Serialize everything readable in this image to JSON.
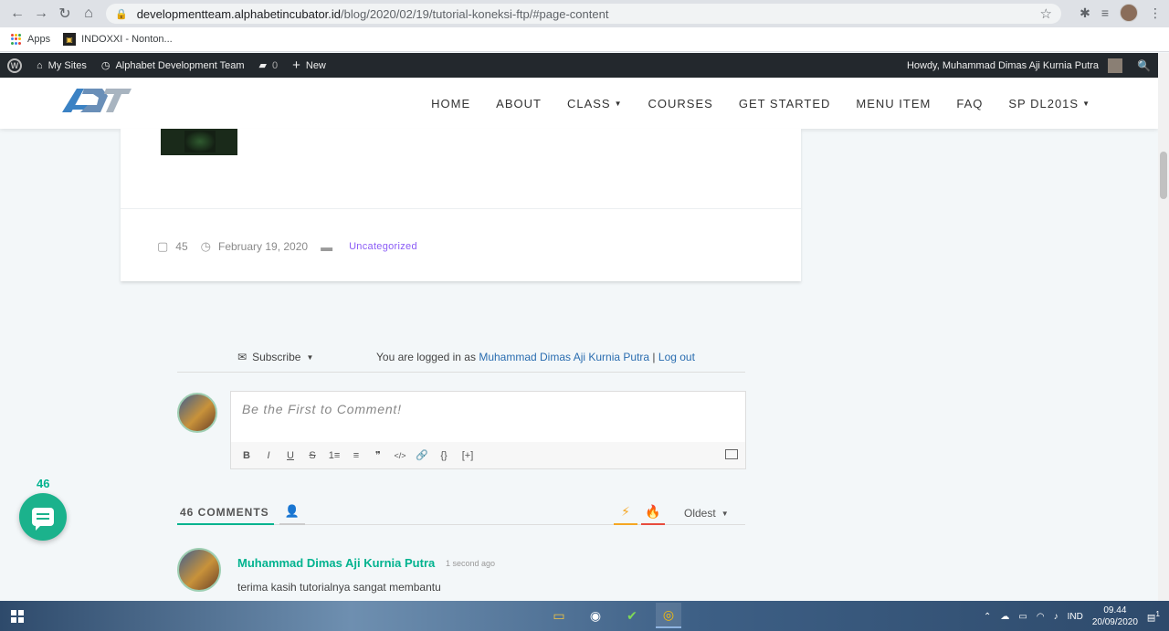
{
  "browser": {
    "url_host": "developmentteam.alphabetincubator.id",
    "url_path": "/blog/2020/02/19/tutorial-koneksi-ftp/#page-content",
    "bookmarks": [
      {
        "label": "Apps"
      },
      {
        "label": "INDOXXI - Nonton..."
      }
    ]
  },
  "wp_admin": {
    "my_sites": "My Sites",
    "site_name": "Alphabet Development Team",
    "comments_count": "0",
    "new_label": "New",
    "howdy": "Howdy, Muhammad Dimas Aji Kurnia Putra"
  },
  "header": {
    "logo_text": "ADT",
    "nav": [
      {
        "label": "HOME",
        "has_caret": false
      },
      {
        "label": "ABOUT",
        "has_caret": false
      },
      {
        "label": "CLASS",
        "has_caret": true
      },
      {
        "label": "COURSES",
        "has_caret": false
      },
      {
        "label": "GET STARTED",
        "has_caret": false
      },
      {
        "label": "MENU ITEM",
        "has_caret": false
      },
      {
        "label": "FAQ",
        "has_caret": false
      },
      {
        "label": "SP DL201S",
        "has_caret": true
      }
    ],
    "caret": "▼"
  },
  "post": {
    "comment_count": "45",
    "date": "February 19, 2020",
    "category": "Uncategorized"
  },
  "comments": {
    "subscribe_label": "Subscribe",
    "logged_in_prefix": "You are logged in as",
    "logged_in_user": "Muhammad Dimas Aji Kurnia Putra",
    "separator": "|",
    "logout": "Log out",
    "placeholder": "Be the First to Comment!",
    "toolbar": [
      "B",
      "I",
      "U",
      "S",
      "1≡",
      "≡",
      "❞",
      "</>",
      "🔗",
      "{}",
      "[+]"
    ],
    "count_label": "46 COMMENTS",
    "sort_label": "Oldest",
    "floating_count": "46",
    "first_comment": {
      "author": "Muhammad Dimas Aji Kurnia Putra",
      "time": "1 second ago",
      "text": "terima kasih tutorialnya sangat membantu"
    }
  },
  "taskbar": {
    "lang": "IND",
    "time": "09.44",
    "date": "20/09/2020",
    "notif": "1"
  },
  "colors": {
    "accent": "#00b38f",
    "link": "#2a6db0",
    "category": "#8b5cf6",
    "admin_bar": "#23282d"
  }
}
